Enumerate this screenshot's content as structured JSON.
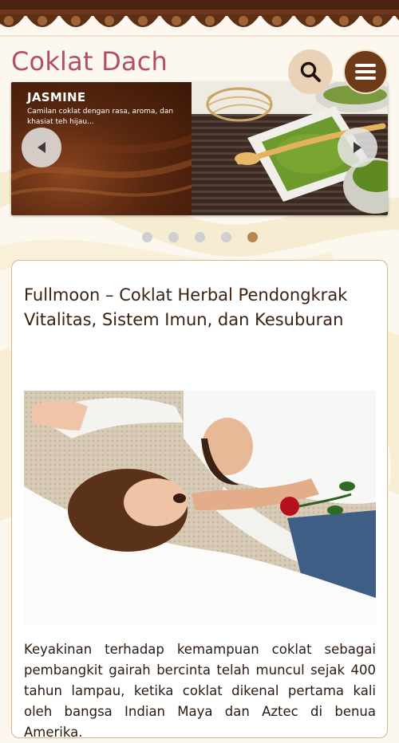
{
  "site": {
    "title": "Coklat Dach"
  },
  "header": {
    "search_icon": "search-icon",
    "menu_icon": "hamburger-menu-icon",
    "menu_bg": "#6e3b1a",
    "search_bg": "#e9d2b5"
  },
  "slider": {
    "title": "JASMINE",
    "description": "Camilan coklat dengan rasa, aroma, dan khasiat teh hijau...",
    "prev_icon": "arrow-left-icon",
    "next_icon": "arrow-right-icon",
    "dots_total": 5,
    "active_dot_index": 4
  },
  "article": {
    "title": "Fullmoon – Coklat Herbal Pendongkrak Vitalitas, Sistem Imun, dan Kesuburan",
    "body": "Keyakinan terhadap kemampuan coklat sebagai pembangkit gairah bercinta telah muncul sejak 400 tahun lampau, ketika coklat dikenal pertama kali oleh bangsa Indian Maya dan Aztec di benua Amerika."
  },
  "colors": {
    "title_pink": "#b24e6a",
    "brown_dark": "#6e3b1a",
    "border_tan": "#d9b389",
    "dot_active": "#b6884f",
    "dot_inactive": "#cfcfcf"
  }
}
